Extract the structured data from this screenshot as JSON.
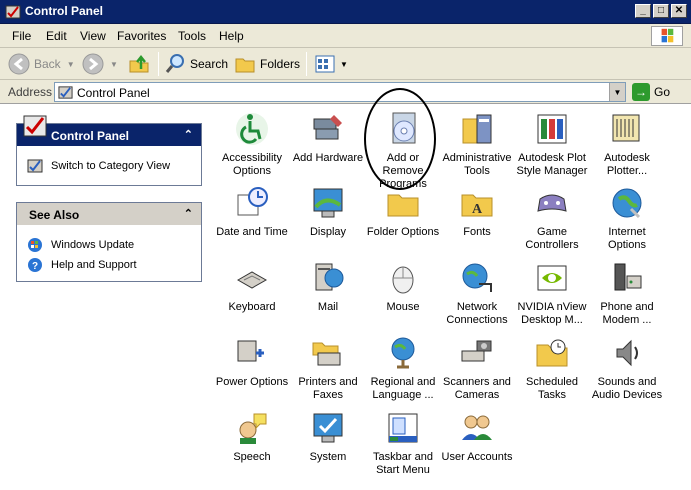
{
  "window": {
    "title": "Control Panel"
  },
  "menu": {
    "file": "File",
    "edit": "Edit",
    "view": "View",
    "favorites": "Favorites",
    "tools": "Tools",
    "help": "Help"
  },
  "toolbar": {
    "back": "Back",
    "search": "Search",
    "folders": "Folders"
  },
  "address": {
    "label": "Address",
    "value": "Control Panel",
    "go": "Go"
  },
  "sidebar": {
    "control_panel": {
      "title": "Control Panel",
      "switch": "Switch to Category View"
    },
    "see_also": {
      "title": "See Also",
      "links": [
        "Windows Update",
        "Help and Support"
      ]
    }
  },
  "items": [
    {
      "label": "Accessibility\nOptions",
      "icon": "accessibility-icon"
    },
    {
      "label": "Add Hardware",
      "icon": "add-hardware-icon"
    },
    {
      "label": "Add or\nRemove\nPrograms",
      "icon": "add-remove-programs-icon"
    },
    {
      "label": "Administrative\nTools",
      "icon": "administrative-tools-icon"
    },
    {
      "label": "Autodesk Plot\nStyle Manager",
      "icon": "autodesk-plot-style-icon"
    },
    {
      "label": "Autodesk\nPlotter...",
      "icon": "autodesk-plotter-icon"
    },
    {
      "label": "Date and Time",
      "icon": "date-time-icon"
    },
    {
      "label": "Display",
      "icon": "display-icon"
    },
    {
      "label": "Folder Options",
      "icon": "folder-options-icon"
    },
    {
      "label": "Fonts",
      "icon": "fonts-icon"
    },
    {
      "label": "Game\nControllers",
      "icon": "game-controllers-icon"
    },
    {
      "label": "Internet\nOptions",
      "icon": "internet-options-icon"
    },
    {
      "label": "Keyboard",
      "icon": "keyboard-icon"
    },
    {
      "label": "Mail",
      "icon": "mail-icon"
    },
    {
      "label": "Mouse",
      "icon": "mouse-icon"
    },
    {
      "label": "Network\nConnections",
      "icon": "network-connections-icon"
    },
    {
      "label": "NVIDIA nView\nDesktop M...",
      "icon": "nvidia-nview-icon"
    },
    {
      "label": "Phone and\nModem ...",
      "icon": "phone-modem-icon"
    },
    {
      "label": "Power Options",
      "icon": "power-options-icon"
    },
    {
      "label": "Printers and\nFaxes",
      "icon": "printers-faxes-icon"
    },
    {
      "label": "Regional and\nLanguage ...",
      "icon": "regional-language-icon"
    },
    {
      "label": "Scanners and\nCameras",
      "icon": "scanners-cameras-icon"
    },
    {
      "label": "Scheduled\nTasks",
      "icon": "scheduled-tasks-icon"
    },
    {
      "label": "Sounds and\nAudio Devices",
      "icon": "sounds-audio-icon"
    },
    {
      "label": "Speech",
      "icon": "speech-icon"
    },
    {
      "label": "System",
      "icon": "system-icon"
    },
    {
      "label": "Taskbar and\nStart Menu",
      "icon": "taskbar-start-menu-icon"
    },
    {
      "label": "User Accounts",
      "icon": "user-accounts-icon"
    }
  ]
}
